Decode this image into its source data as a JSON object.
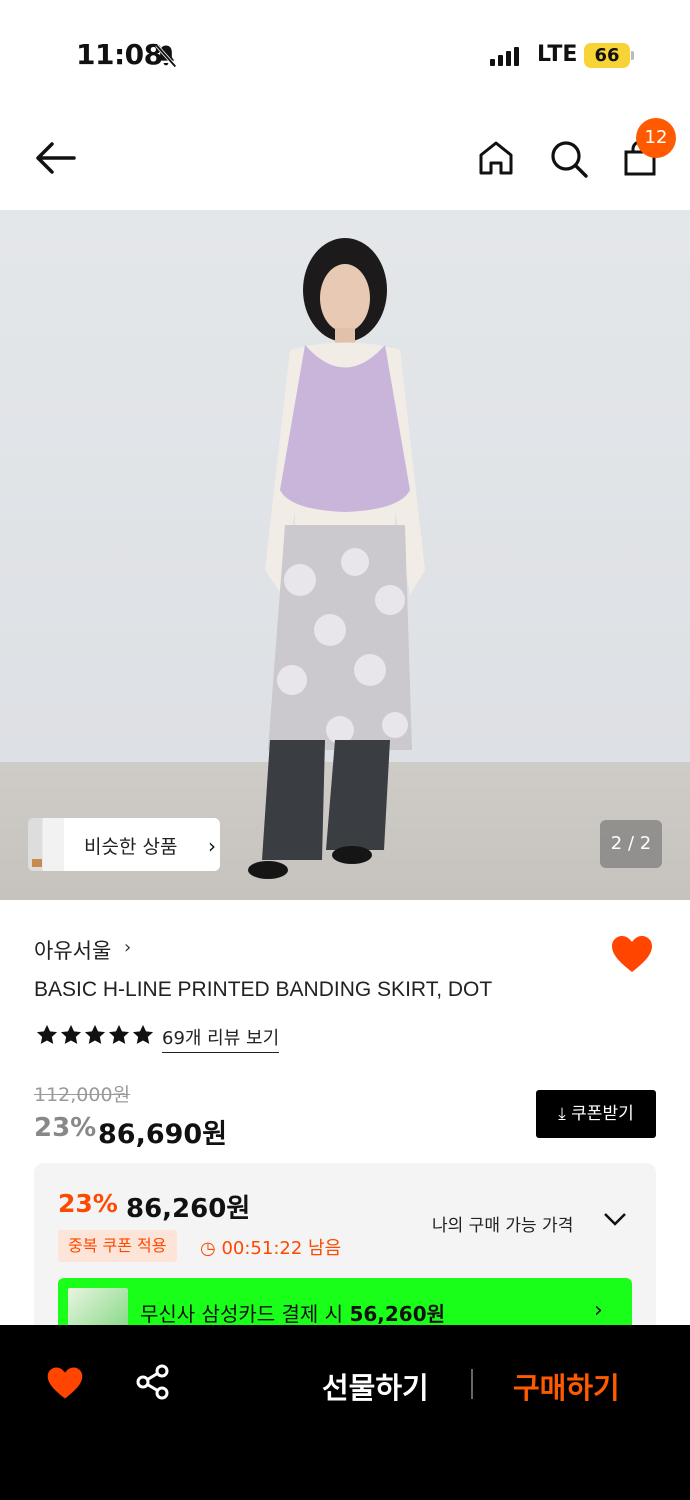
{
  "status_bar": {
    "time": "11:08",
    "network": "LTE",
    "battery": "66",
    "icons": [
      "bell-off-icon",
      "signal-icon"
    ]
  },
  "header": {
    "cart_count": "12",
    "icons": [
      "back-arrow-icon",
      "home-icon",
      "search-icon",
      "cart-icon"
    ]
  },
  "gallery": {
    "similar_label": "비슷한 상품",
    "pager": "2 / 2"
  },
  "product": {
    "brand": "아유서울",
    "name": "BASIC H-LINE PRINTED BANDING SKIRT, DOT",
    "rating": 5,
    "review_link": "69개 리뷰 보기",
    "original_price": "112,000원",
    "discount": "23%",
    "price": "86,690원",
    "coupon_button": "쿠폰받기"
  },
  "benefit": {
    "discount": "23%",
    "price": "86,260원",
    "tag": "중복 쿠폰 적용",
    "timer": "00:51:22 남음",
    "my_price_label": "나의 구매 가능 가격",
    "card_promo_prefix": "무신사 삼성카드 결제 시 ",
    "card_promo_price": "56,260원"
  },
  "bottom_bar": {
    "gift_label": "선물하기",
    "buy_label": "구매하기"
  },
  "colors": {
    "accent": "#ff5a00",
    "heart": "#ff4500",
    "promo_green": "#1aff1a"
  }
}
